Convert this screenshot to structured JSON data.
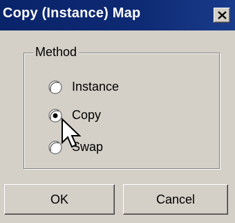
{
  "window": {
    "title": "Copy (Instance) Map",
    "close_icon": "close-icon"
  },
  "method_group": {
    "label": "Method",
    "options": [
      {
        "label": "Instance",
        "selected": false,
        "enabled": true
      },
      {
        "label": "Copy",
        "selected": true,
        "enabled": true
      },
      {
        "label": "Swap",
        "selected": false,
        "enabled": true
      }
    ]
  },
  "buttons": {
    "ok": "OK",
    "cancel": "Cancel"
  },
  "colors": {
    "titlebar": "#0a246a",
    "face": "#d4d0c8",
    "title_text": "#ffffff"
  }
}
